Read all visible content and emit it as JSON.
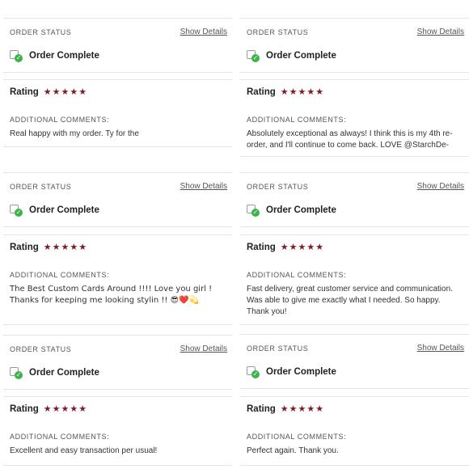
{
  "cards": [
    {
      "status_label": "ORDER STATUS",
      "show_details": "Show Details",
      "status_text": "Order Complete",
      "rating_label": "Rating",
      "stars": 5,
      "comments_label": "ADDITIONAL COMMENTS:",
      "comment": "Real happy with my order. Ty for the"
    },
    {
      "status_label": "ORDER STATUS",
      "show_details": "Show Details",
      "status_text": "Order Complete",
      "rating_label": "Rating",
      "stars": 5,
      "comments_label": "ADDITIONAL COMMENTS:",
      "comment": "Absolutely exceptional as always! I think this is my 4th re-order, and I'll continue to come back. LOVE @StarchDe-"
    },
    {
      "status_label": "ORDER STATUS",
      "show_details": "Show Details",
      "status_text": "Order Complete",
      "rating_label": "Rating",
      "stars": 5,
      "comments_label": "ADDITIONAL COMMENTS:",
      "comment": "The Best Custom Cards Around !!!! Love you girl ! Thanks for keeping me looking stylin !! 😎❤️💫"
    },
    {
      "status_label": "ORDER STATUS",
      "show_details": "Show Details",
      "status_text": "Order Complete",
      "rating_label": "Rating",
      "stars": 5,
      "comments_label": "ADDITIONAL COMMENTS:",
      "comment": "Fast delivery, great customer service and communication. Was able to give me exactly what I needed. So happy. Thank you!"
    },
    {
      "status_label": "ORDER STATUS",
      "show_details": "Show Details",
      "status_text": "Order Complete",
      "rating_label": "Rating",
      "stars": 5,
      "comments_label": "ADDITIONAL COMMENTS:",
      "comment": "Excellent and easy transaction per usual!"
    },
    {
      "status_label": "ORDER STATUS",
      "show_details": "Show Details",
      "status_text": "Order Complete",
      "rating_label": "Rating",
      "stars": 5,
      "comments_label": "ADDITIONAL COMMENTS:",
      "comment": "Perfect again. Thank you."
    }
  ],
  "colors": {
    "star": "#7a1b2e",
    "check": "#3db34a",
    "divider": "#e4e4e4"
  },
  "icons": {
    "status": "order-complete-check-icon",
    "star": "star-icon"
  }
}
